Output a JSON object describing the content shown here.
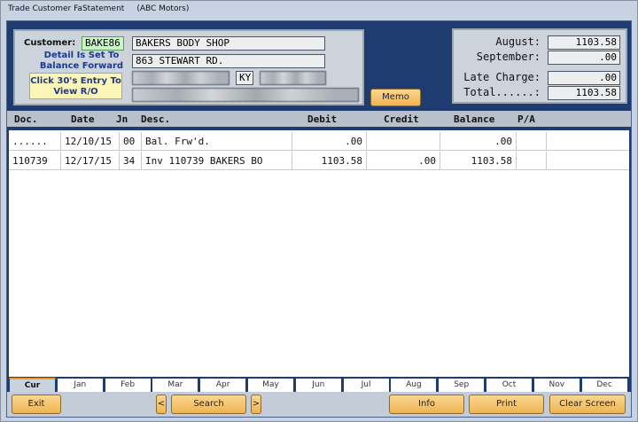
{
  "window": {
    "title": "Trade Customer FaStatement",
    "company": "(ABC Motors)"
  },
  "customer": {
    "label": "Customer:",
    "code": "BAKE86",
    "name": "BAKERS BODY SHOP",
    "address": "863 STEWART RD.",
    "state": "KY",
    "detail_note": "Detail Is Set To Balance Forward",
    "click_note": "Click 30's Entry To View R/O"
  },
  "memo_label": "Memo",
  "summary": [
    {
      "label": "August:",
      "value": "1103.58"
    },
    {
      "label": "September:",
      "value": ".00"
    },
    {
      "label": "Late Charge:",
      "value": ".00"
    },
    {
      "label": "Total......:",
      "value": "1103.58"
    }
  ],
  "table": {
    "columns": [
      "Doc.",
      "Date",
      "Jn",
      "Desc.",
      "Debit",
      "Credit",
      "Balance",
      "P/A"
    ],
    "rows": [
      [
        "......",
        "12/10/15",
        "00",
        "Bal. Frw'd.",
        ".00",
        "",
        ".00",
        ""
      ],
      [
        "110739",
        "12/17/15",
        "34",
        "Inv 110739 BAKERS BO",
        "1103.58",
        ".00",
        "1103.58",
        ""
      ]
    ]
  },
  "tabs": [
    "Cur",
    "Jan",
    "Feb",
    "Mar",
    "Apr",
    "May",
    "Jun",
    "Jul",
    "Aug",
    "Sep",
    "Oct",
    "Nov",
    "Dec"
  ],
  "active_tab": "Cur",
  "buttons": {
    "exit": "Exit",
    "prev": "<",
    "search": "Search",
    "next": ">",
    "info": "Info",
    "print": "Print",
    "clear": "Clear Screen"
  },
  "colors": {
    "frame": "#1f3c70",
    "button": "#f2c06a",
    "note": "#fbf6b8",
    "code_field": "#c9f5c9"
  }
}
